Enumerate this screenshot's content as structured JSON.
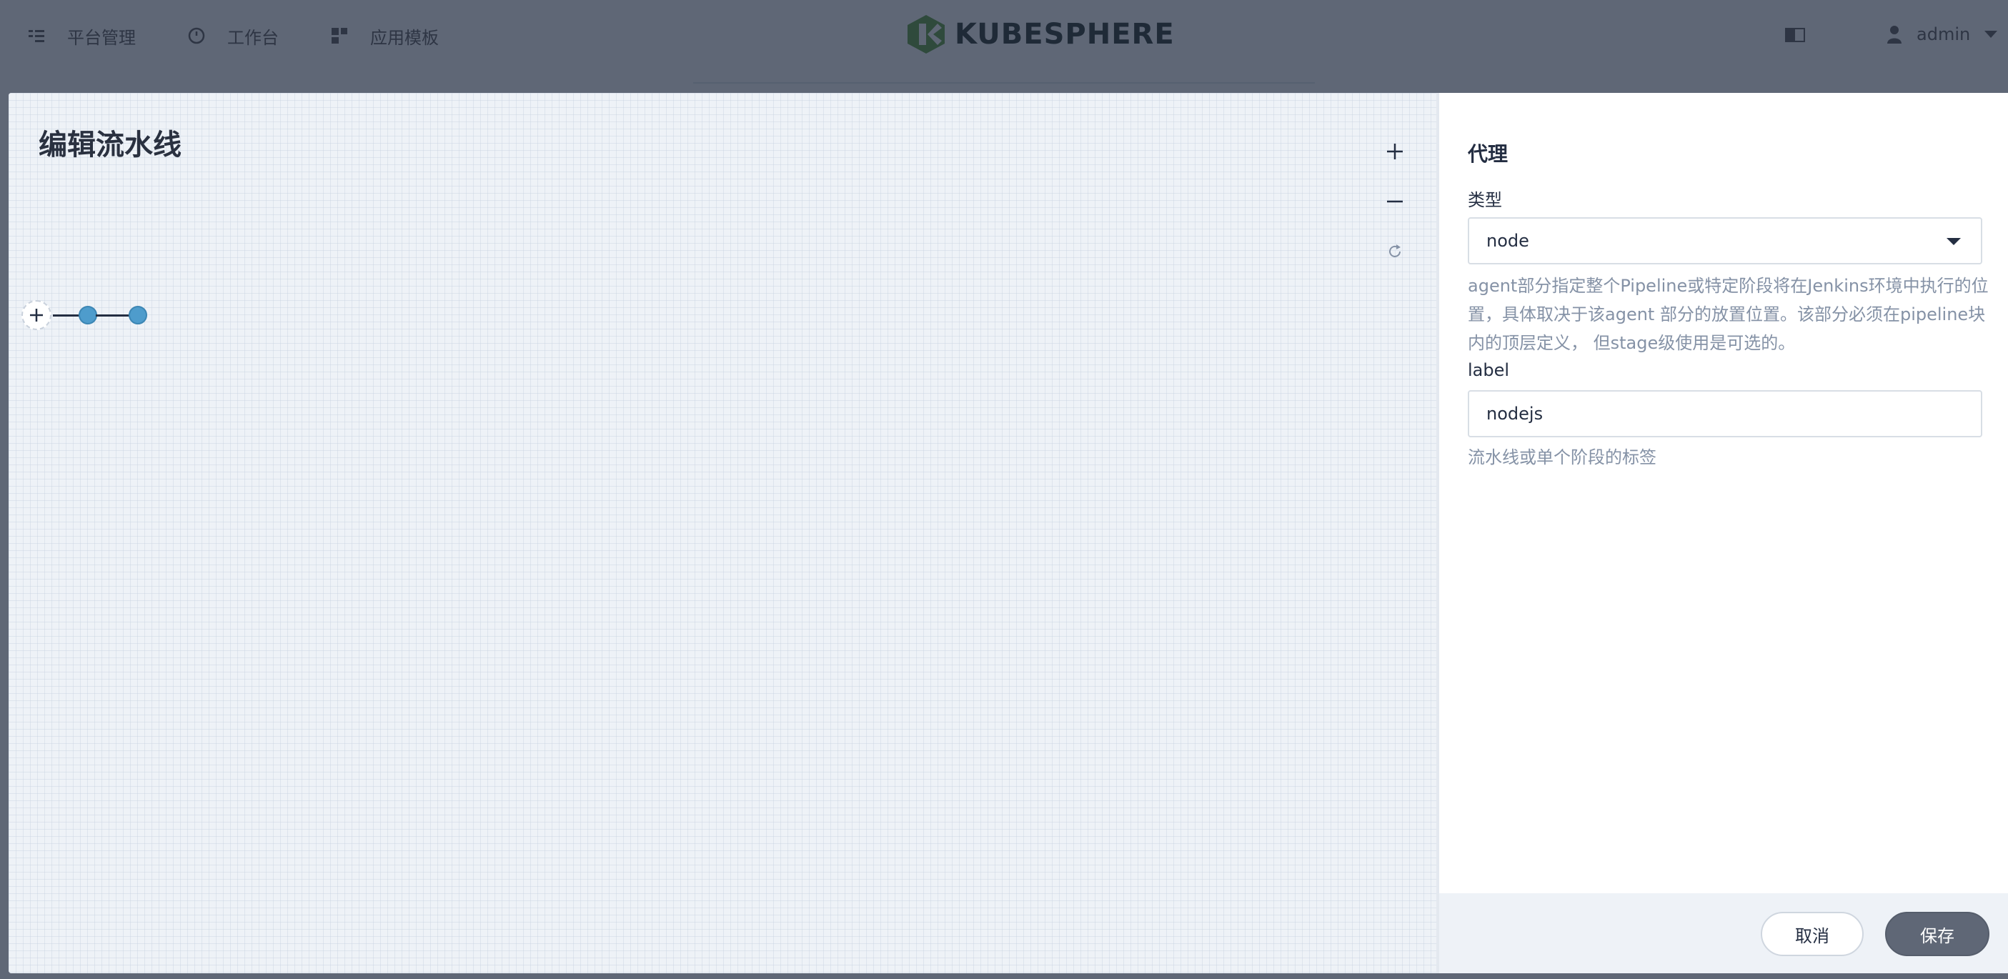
{
  "nav": {
    "items": [
      {
        "label": "平台管理",
        "icon": "list-icon"
      },
      {
        "label": "工作台",
        "icon": "clock-icon"
      },
      {
        "label": "应用模板",
        "icon": "grid-icon"
      }
    ],
    "logo_text": "KUBESPHERE",
    "user_name": "admin"
  },
  "canvas": {
    "title": "编辑流水线",
    "zoom_in_icon": "plus-icon",
    "zoom_out_icon": "minus-icon",
    "reset_icon": "refresh-icon"
  },
  "panel": {
    "title": "代理",
    "type_label": "类型",
    "type_value": "node",
    "type_help": "agent部分指定整个Pipeline或特定阶段将在Jenkins环境中执行的位置，具体取决于该agent 部分的放置位置。该部分必须在pipeline块内的顶层定义， 但stage级使用是可选的。",
    "label_label": "label",
    "label_value": "nodejs",
    "label_help": "流水线或单个阶段的标签",
    "cancel_label": "取消",
    "save_label": "保存"
  },
  "colors": {
    "overlay": "#5f6776",
    "accent_dot": "#4e9ccc",
    "save_button": "#5f6776"
  }
}
